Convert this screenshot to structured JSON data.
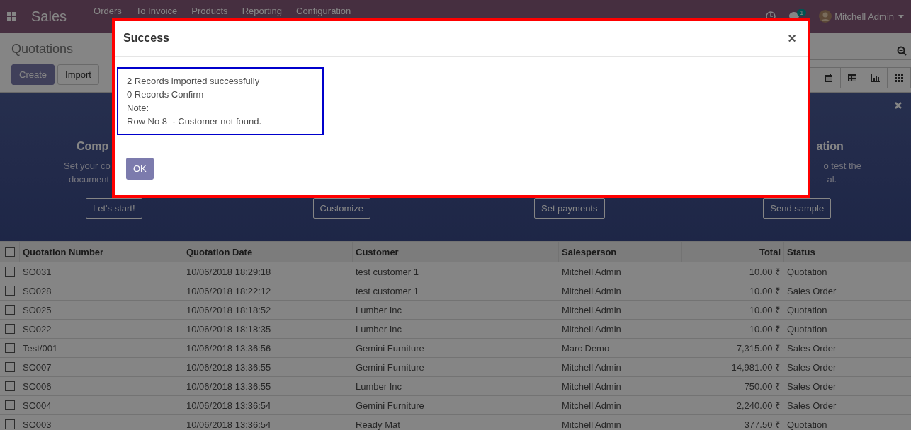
{
  "navbar": {
    "app_name": "Sales",
    "menu": [
      "Orders",
      "To Invoice",
      "Products",
      "Reporting",
      "Configuration"
    ],
    "chat_count": "1",
    "user": "Mitchell Admin"
  },
  "control_panel": {
    "breadcrumb": "Quotations",
    "buttons": [
      "Create",
      "Import"
    ]
  },
  "banner": {
    "columns": [
      {
        "title": "Comp",
        "lines": [
          "Set your co",
          "document"
        ],
        "button": "Let's start!"
      },
      {
        "button": "Customize"
      },
      {
        "button": "Set payments"
      },
      {
        "title": "ation",
        "lines": [
          "o test the",
          "al."
        ],
        "button": "Send sample"
      }
    ]
  },
  "table": {
    "select_all_checked": false,
    "columns": [
      "Quotation Number",
      "Quotation Date",
      "Customer",
      "Salesperson",
      "Total",
      "Status"
    ],
    "rows": [
      {
        "checked": false,
        "cells": [
          "SO031",
          "10/06/2018 18:29:18",
          "test customer 1",
          "Mitchell Admin",
          "10.00 ₹",
          "Quotation"
        ]
      },
      {
        "checked": false,
        "cells": [
          "SO028",
          "10/06/2018 18:22:12",
          "test customer 1",
          "Mitchell Admin",
          "10.00 ₹",
          "Sales Order"
        ]
      },
      {
        "checked": false,
        "cells": [
          "SO025",
          "10/06/2018 18:18:52",
          "Lumber Inc",
          "Mitchell Admin",
          "10.00 ₹",
          "Quotation"
        ]
      },
      {
        "checked": false,
        "cells": [
          "SO022",
          "10/06/2018 18:18:35",
          "Lumber Inc",
          "Mitchell Admin",
          "10.00 ₹",
          "Quotation"
        ]
      },
      {
        "checked": false,
        "cells": [
          "Test/001",
          "10/06/2018 13:36:56",
          "Gemini Furniture",
          "Marc Demo",
          "7,315.00 ₹",
          "Sales Order"
        ]
      },
      {
        "checked": false,
        "cells": [
          "SO007",
          "10/06/2018 13:36:55",
          "Gemini Furniture",
          "Mitchell Admin",
          "14,981.00 ₹",
          "Sales Order"
        ]
      },
      {
        "checked": false,
        "cells": [
          "SO006",
          "10/06/2018 13:36:55",
          "Lumber Inc",
          "Mitchell Admin",
          "750.00 ₹",
          "Sales Order"
        ]
      },
      {
        "checked": false,
        "cells": [
          "SO004",
          "10/06/2018 13:36:54",
          "Gemini Furniture",
          "Mitchell Admin",
          "2,240.00 ₹",
          "Sales Order"
        ]
      },
      {
        "checked": false,
        "cells": [
          "SO003",
          "10/06/2018 13:36:54",
          "Ready Mat",
          "Mitchell Admin",
          "377.50 ₹",
          "Quotation"
        ]
      }
    ]
  },
  "dialog": {
    "title": "Success",
    "close": "×",
    "messages": [
      "2 Records imported successfully",
      "0 Records Confirm",
      "Note:",
      "Row No 8  - Customer not found."
    ],
    "button": "OK"
  }
}
